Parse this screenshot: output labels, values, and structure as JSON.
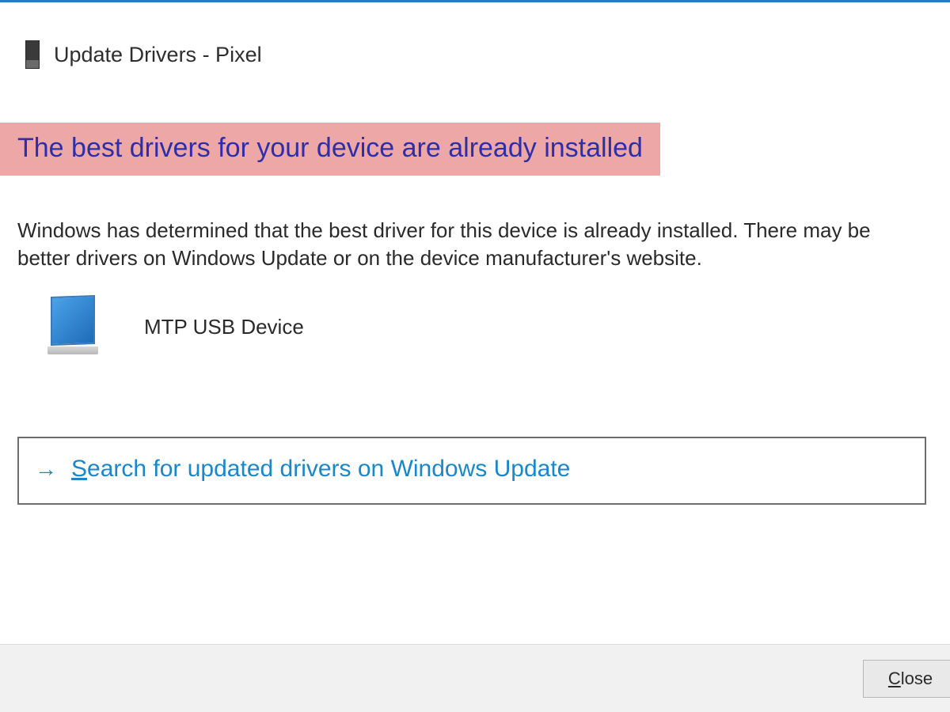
{
  "header": {
    "title": "Update Drivers - Pixel"
  },
  "main": {
    "heading": "The best drivers for your device are already installed",
    "body_text": "Windows has determined that the best driver for this device is already installed. There may be better drivers on Windows Update or on the device manufacturer's website.",
    "device_name": "MTP USB Device"
  },
  "link": {
    "text_prefix_underlined": "S",
    "text_rest": "earch for updated drivers on Windows Update"
  },
  "footer": {
    "close_prefix_underlined": "C",
    "close_rest": "lose"
  }
}
